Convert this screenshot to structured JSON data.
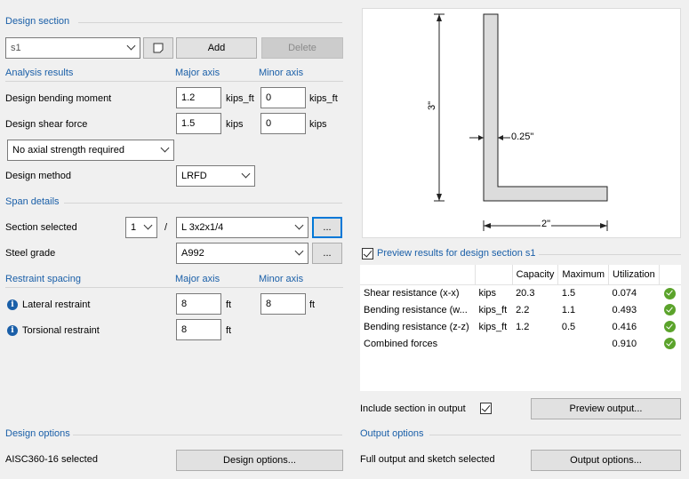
{
  "design_section": {
    "title": "Design section",
    "selected": "s1",
    "add_label": "Add",
    "delete_label": "Delete"
  },
  "analysis": {
    "title": "Analysis results",
    "major_axis": "Major axis",
    "minor_axis": "Minor axis",
    "moment_label": "Design bending moment",
    "moment_major": "1.2",
    "moment_major_unit": "kips_ft",
    "moment_minor": "0",
    "moment_minor_unit": "kips_ft",
    "shear_label": "Design shear force",
    "shear_major": "1.5",
    "shear_major_unit": "kips",
    "shear_minor": "0",
    "shear_minor_unit": "kips",
    "axial_option": "No axial strength required",
    "method_label": "Design method",
    "method_value": "LRFD"
  },
  "span": {
    "title": "Span details",
    "section_label": "Section selected",
    "section_count": "1",
    "separator": "/",
    "section_value": "L 3x2x1/4",
    "browse_label": "...",
    "grade_label": "Steel grade",
    "grade_value": "A992",
    "grade_browse": "..."
  },
  "restraint": {
    "title": "Restraint spacing",
    "major_axis": "Major axis",
    "minor_axis": "Minor axis",
    "lateral_label": "Lateral restraint",
    "lateral_major": "8",
    "lateral_major_unit": "ft",
    "lateral_minor": "8",
    "lateral_minor_unit": "ft",
    "torsional_label": "Torsional restraint",
    "torsional_major": "8",
    "torsional_major_unit": "ft"
  },
  "sketch": {
    "height_dim": "3\"",
    "thickness_dim": "0.25\"",
    "width_dim": "2\""
  },
  "preview": {
    "checkbox_label": "Preview results for design section s1",
    "headers": [
      "",
      "",
      "Capacity",
      "Maximum",
      "Utilization",
      ""
    ],
    "rows": [
      {
        "name": "Shear resistance (x-x)",
        "unit": "kips",
        "capacity": "20.3",
        "maximum": "1.5",
        "utilization": "0.074"
      },
      {
        "name": "Bending resistance (w...",
        "unit": "kips_ft",
        "capacity": "2.2",
        "maximum": "1.1",
        "utilization": "0.493"
      },
      {
        "name": "Bending resistance (z-z)",
        "unit": "kips_ft",
        "capacity": "1.2",
        "maximum": "0.5",
        "utilization": "0.416"
      },
      {
        "name": "Combined forces",
        "unit": "",
        "capacity": "",
        "maximum": "",
        "utilization": "0.910"
      }
    ],
    "include_label": "Include section in output",
    "preview_output_label": "Preview output..."
  },
  "design_options": {
    "title": "Design options",
    "status": "AISC360-16 selected",
    "button_label": "Design options..."
  },
  "output_options": {
    "title": "Output options",
    "status": "Full output and sketch selected",
    "button_label": "Output options..."
  },
  "colors": {
    "accent": "#1a5fa8",
    "ok": "#5ba32b",
    "section_fill": "#dcdcdc"
  }
}
